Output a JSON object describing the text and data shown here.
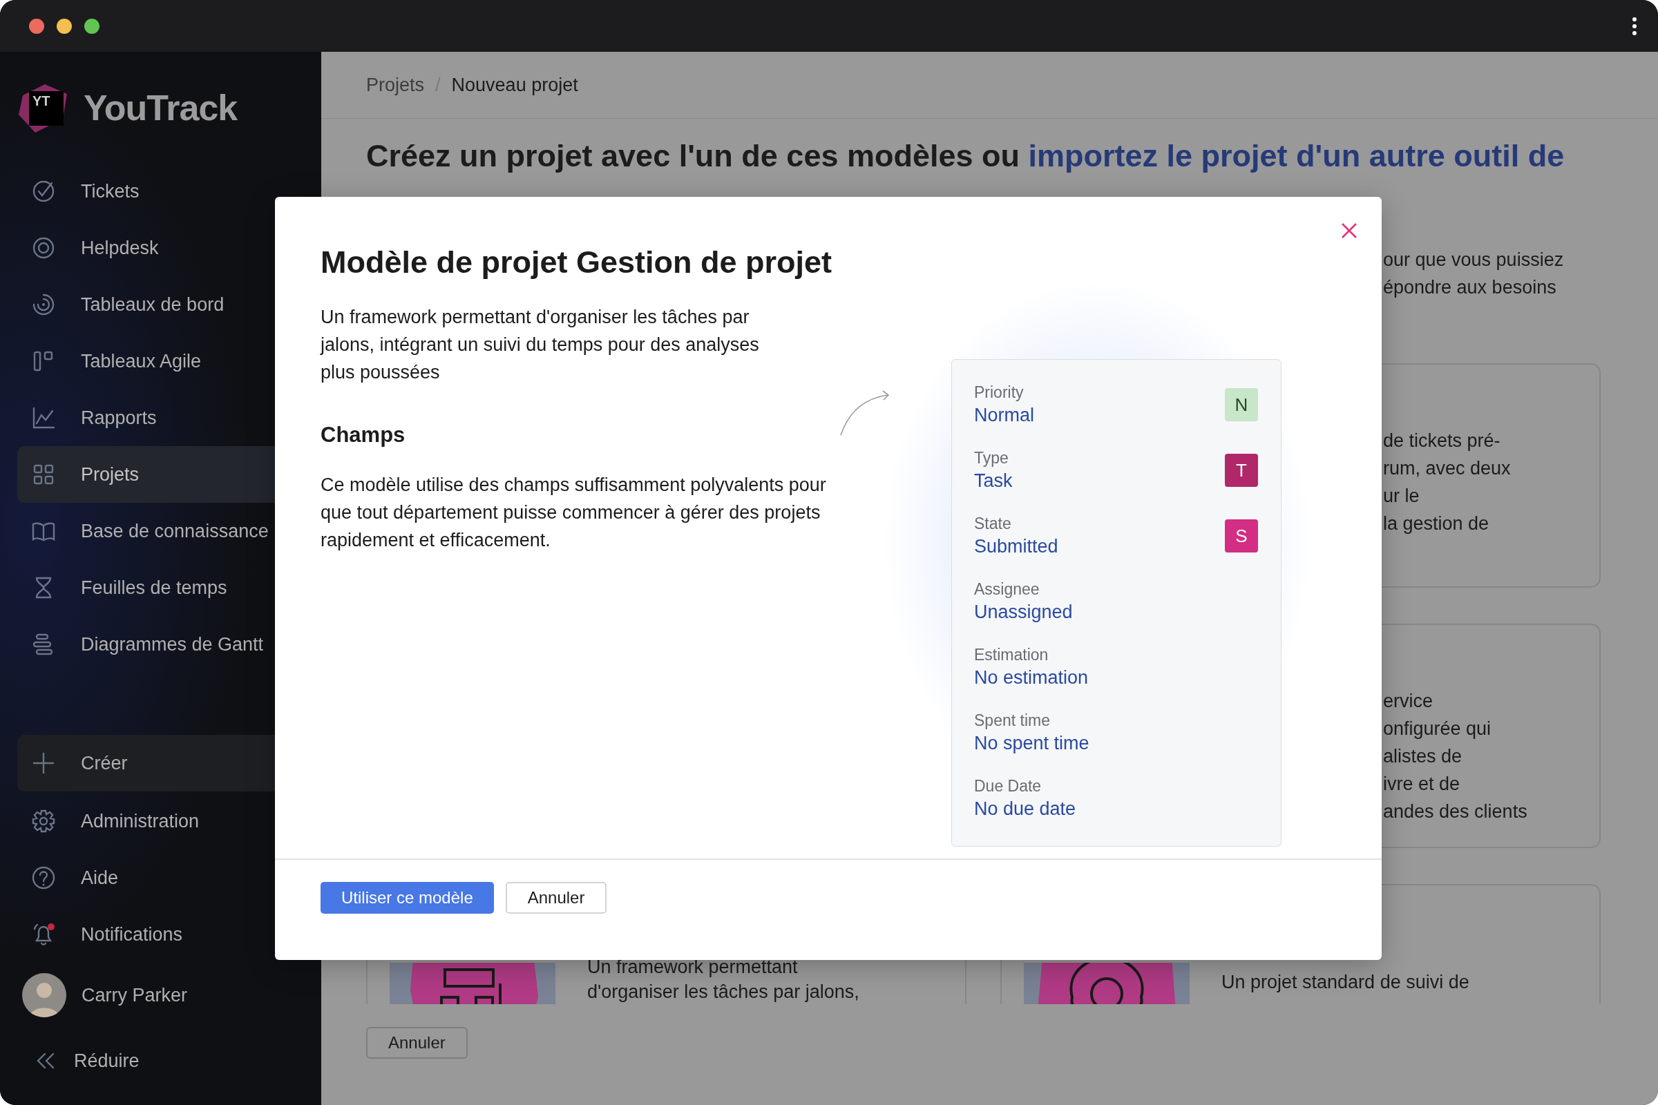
{
  "sidebar": {
    "logo_mark": "YT",
    "logo_text": "YouTrack",
    "nav": [
      {
        "label": "Tickets",
        "selected": false
      },
      {
        "label": "Helpdesk",
        "selected": false
      },
      {
        "label": "Tableaux de bord",
        "selected": false
      },
      {
        "label": "Tableaux Agile",
        "selected": false
      },
      {
        "label": "Rapports",
        "selected": false
      },
      {
        "label": "Projets",
        "selected": true
      },
      {
        "label": "Base de connaissance",
        "selected": false
      },
      {
        "label": "Feuilles de temps",
        "selected": false
      },
      {
        "label": "Diagrammes de Gantt",
        "selected": false
      }
    ],
    "actions": [
      {
        "label": "Créer",
        "kind": "create",
        "unread": false
      },
      {
        "label": "Administration",
        "kind": "link",
        "unread": false
      },
      {
        "label": "Aide",
        "kind": "link",
        "unread": false
      },
      {
        "label": "Notifications",
        "kind": "link",
        "unread": true
      }
    ],
    "user": {
      "name": "Carry Parker"
    },
    "collapse": {
      "label": "Réduire"
    }
  },
  "breadcrumb": {
    "items": [
      "Projets",
      "Nouveau projet"
    ],
    "separator": "/"
  },
  "page": {
    "heading": "Créez un projet avec l'un de ces modèles ou ",
    "heading_link": "importez le projet d'un autre outil de",
    "intro": "our que vous puissiez\népondre aux besoins",
    "cards": [
      {
        "text": "de tickets pré-\nrum, avec deux\nur le\nla gestion de"
      },
      {
        "text": "ervice\nonfigurée qui\nalistes de\nivre et de\nandes des clients"
      }
    ],
    "bottom_cards": [
      {
        "text": "Un framework permettant\nd'organiser les tâches par jalons,"
      },
      {
        "text": "Un projet standard de suivi de"
      }
    ],
    "cancel": "Annuler"
  },
  "modal": {
    "title": "Modèle de projet Gestion de projet",
    "description": "Un framework permettant d'organiser les tâches par jalons, intégrant un suivi du temps pour des analyses plus poussées",
    "section_title": "Champs",
    "section_text": "Ce modèle utilise des champs suffisamment polyvalents pour que tout département puisse commencer à gérer des projets rapidement et efficacement.",
    "fields": [
      {
        "label": "Priority",
        "value": "Normal",
        "badge": "N",
        "color": "#c8e6c9"
      },
      {
        "label": "Type",
        "value": "Task",
        "badge": "T",
        "color": "#b0276a"
      },
      {
        "label": "State",
        "value": "Submitted",
        "badge": "S",
        "color": "#d42d84"
      },
      {
        "label": "Assignee",
        "value": "Unassigned"
      },
      {
        "label": "Estimation",
        "value": "No estimation"
      },
      {
        "label": "Spent time",
        "value": "No spent time"
      },
      {
        "label": "Due Date",
        "value": "No due date"
      }
    ],
    "primary_button": "Utiliser ce modèle",
    "cancel_button": "Annuler"
  }
}
